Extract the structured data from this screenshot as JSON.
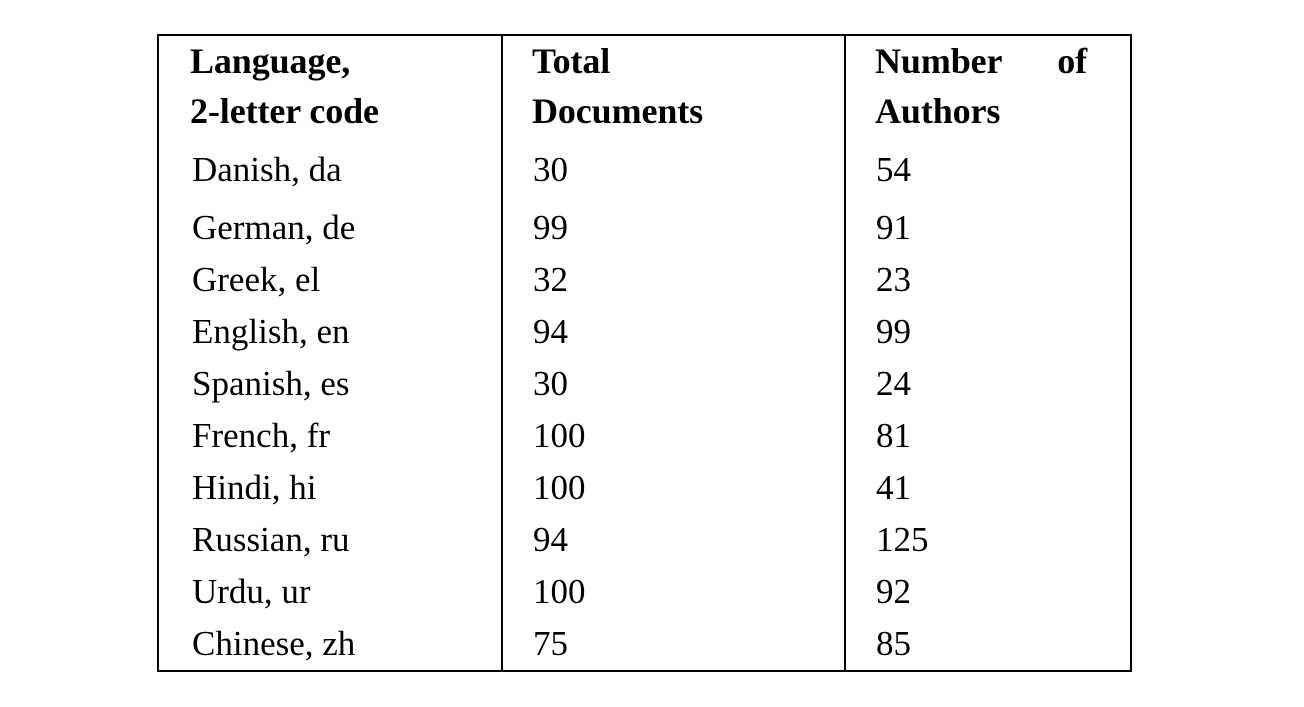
{
  "table": {
    "columns": [
      {
        "id": "language",
        "header_line1": "Language,",
        "header_line2": "2-letter code"
      },
      {
        "id": "total_documents",
        "header_line1": "Total",
        "header_line2": "Documents"
      },
      {
        "id": "number_of_authors",
        "header_line1_word1": "Number",
        "header_line1_word2": "of",
        "header_line2": "Authors"
      }
    ],
    "rows": [
      {
        "language": "Danish, da",
        "total_documents": "30",
        "number_of_authors": "54"
      },
      {
        "language": "German, de",
        "total_documents": "99",
        "number_of_authors": "91"
      },
      {
        "language": "Greek, el",
        "total_documents": "32",
        "number_of_authors": "23"
      },
      {
        "language": "English, en",
        "total_documents": "94",
        "number_of_authors": "99"
      },
      {
        "language": "Spanish, es",
        "total_documents": "30",
        "number_of_authors": "24"
      },
      {
        "language": "French, fr",
        "total_documents": "100",
        "number_of_authors": "81"
      },
      {
        "language": "Hindi, hi",
        "total_documents": "100",
        "number_of_authors": "41"
      },
      {
        "language": "Russian, ru",
        "total_documents": "94",
        "number_of_authors": "125"
      },
      {
        "language": "Urdu, ur",
        "total_documents": "100",
        "number_of_authors": "92"
      },
      {
        "language": "Chinese, zh",
        "total_documents": "75",
        "number_of_authors": "85"
      }
    ]
  },
  "colors": {
    "text": "#000000",
    "background": "#ffffff",
    "rule": "#000000"
  }
}
